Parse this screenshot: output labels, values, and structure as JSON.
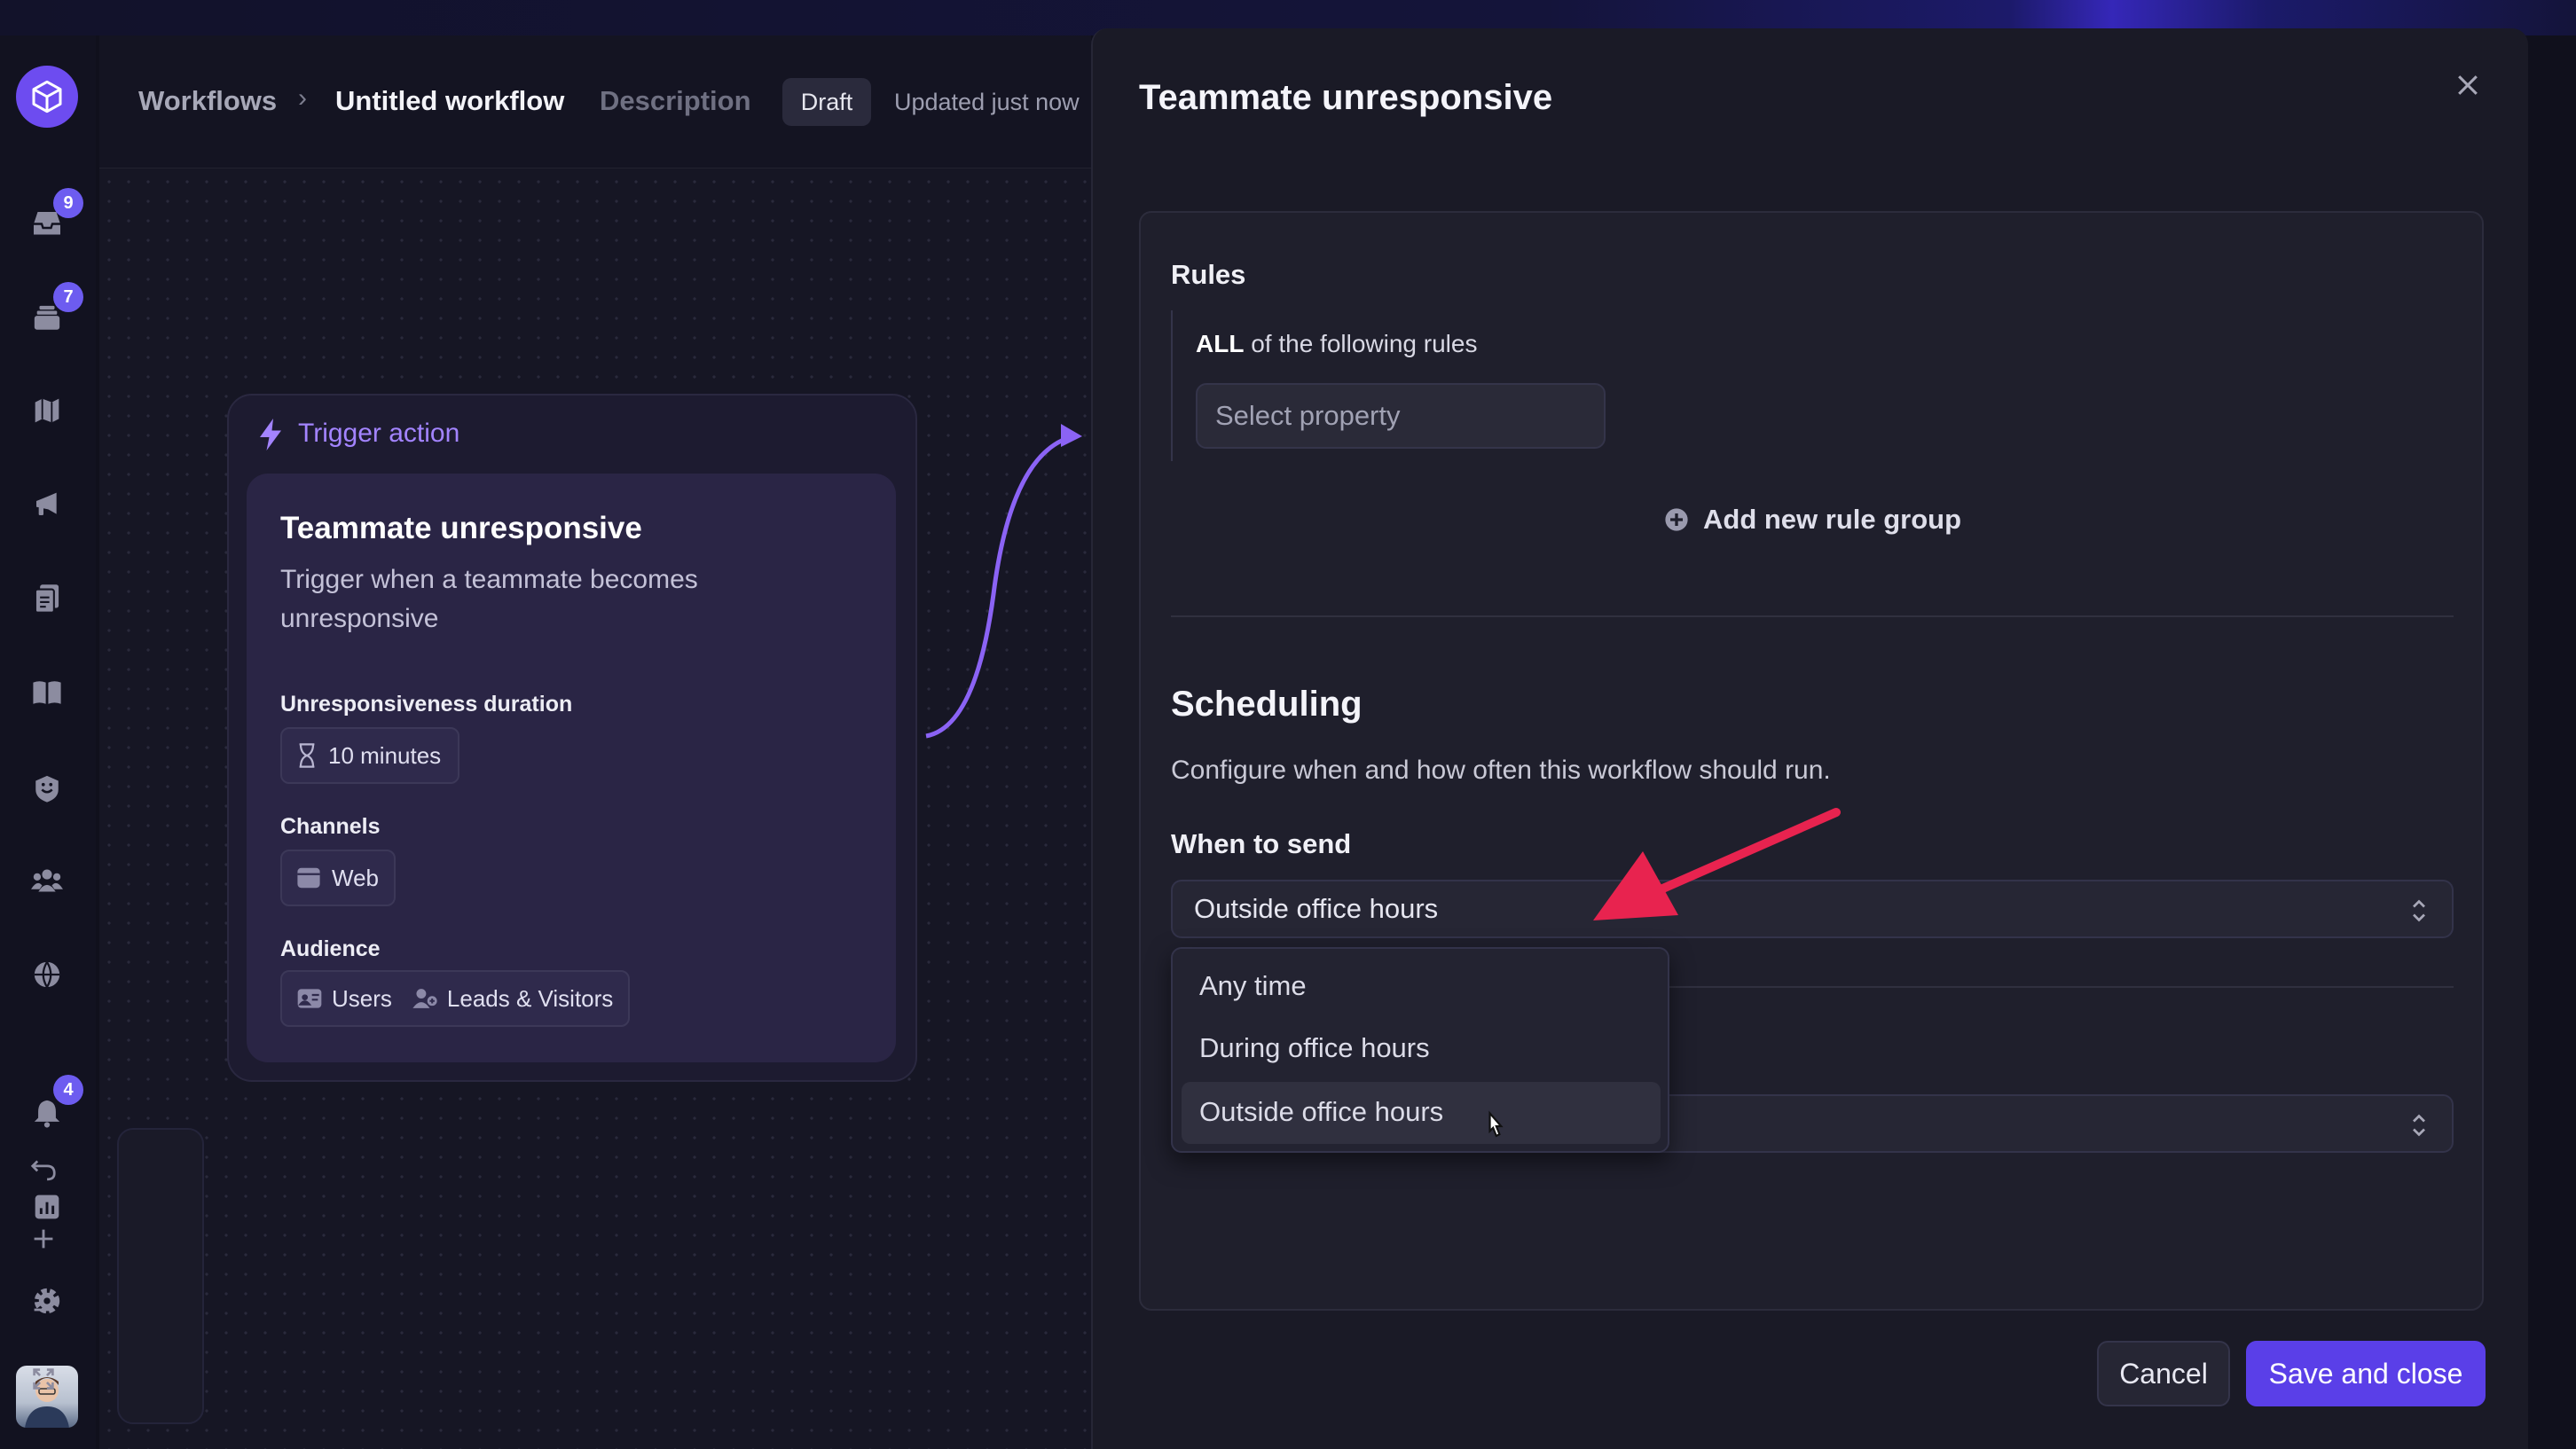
{
  "header": {
    "breadcrumb_root": "Workflows",
    "breadcrumb_sep": "›",
    "workflow_title": "Untitled workflow",
    "description_link": "Description",
    "status_badge": "Draft",
    "updated_text": "Updated just now"
  },
  "sidebar": {
    "badges": {
      "inbox": "9",
      "tickets": "7",
      "notifications": "4"
    },
    "icons": [
      "inbox-icon",
      "tickets-icon",
      "map-icon",
      "megaphone-icon",
      "clipboard-icon",
      "book-icon",
      "fin-icon",
      "contacts-icon",
      "globe-icon",
      "bell-icon",
      "reports-icon",
      "settings-icon"
    ]
  },
  "trigger": {
    "label": "Trigger action",
    "title": "Teammate unresponsive",
    "description": "Trigger when a teammate becomes unresponsive",
    "duration_label": "Unresponsiveness duration",
    "duration_value": "10 minutes",
    "channels_label": "Channels",
    "channel_value": "Web",
    "audience_label": "Audience",
    "audience_users": "Users",
    "audience_leads": "Leads & Visitors"
  },
  "panel": {
    "title": "Teammate unresponsive",
    "rules": {
      "title": "Rules",
      "all_prefix": "ALL",
      "all_suffix": " of the following rules",
      "select_placeholder": "Select property",
      "add_group": "Add new rule group"
    },
    "scheduling": {
      "title": "Scheduling",
      "description": "Configure when and how often this workflow should run.",
      "when_label": "When to send",
      "when_value": "Outside office hours",
      "options": [
        "Any time",
        "During office hours",
        "Outside office hours"
      ]
    },
    "cancel_label": "Cancel",
    "save_label": "Save and close"
  },
  "colors": {
    "accent": "#5a3fe8",
    "trigger_purple": "#a384ff",
    "annotation_arrow": "#e8234f"
  }
}
